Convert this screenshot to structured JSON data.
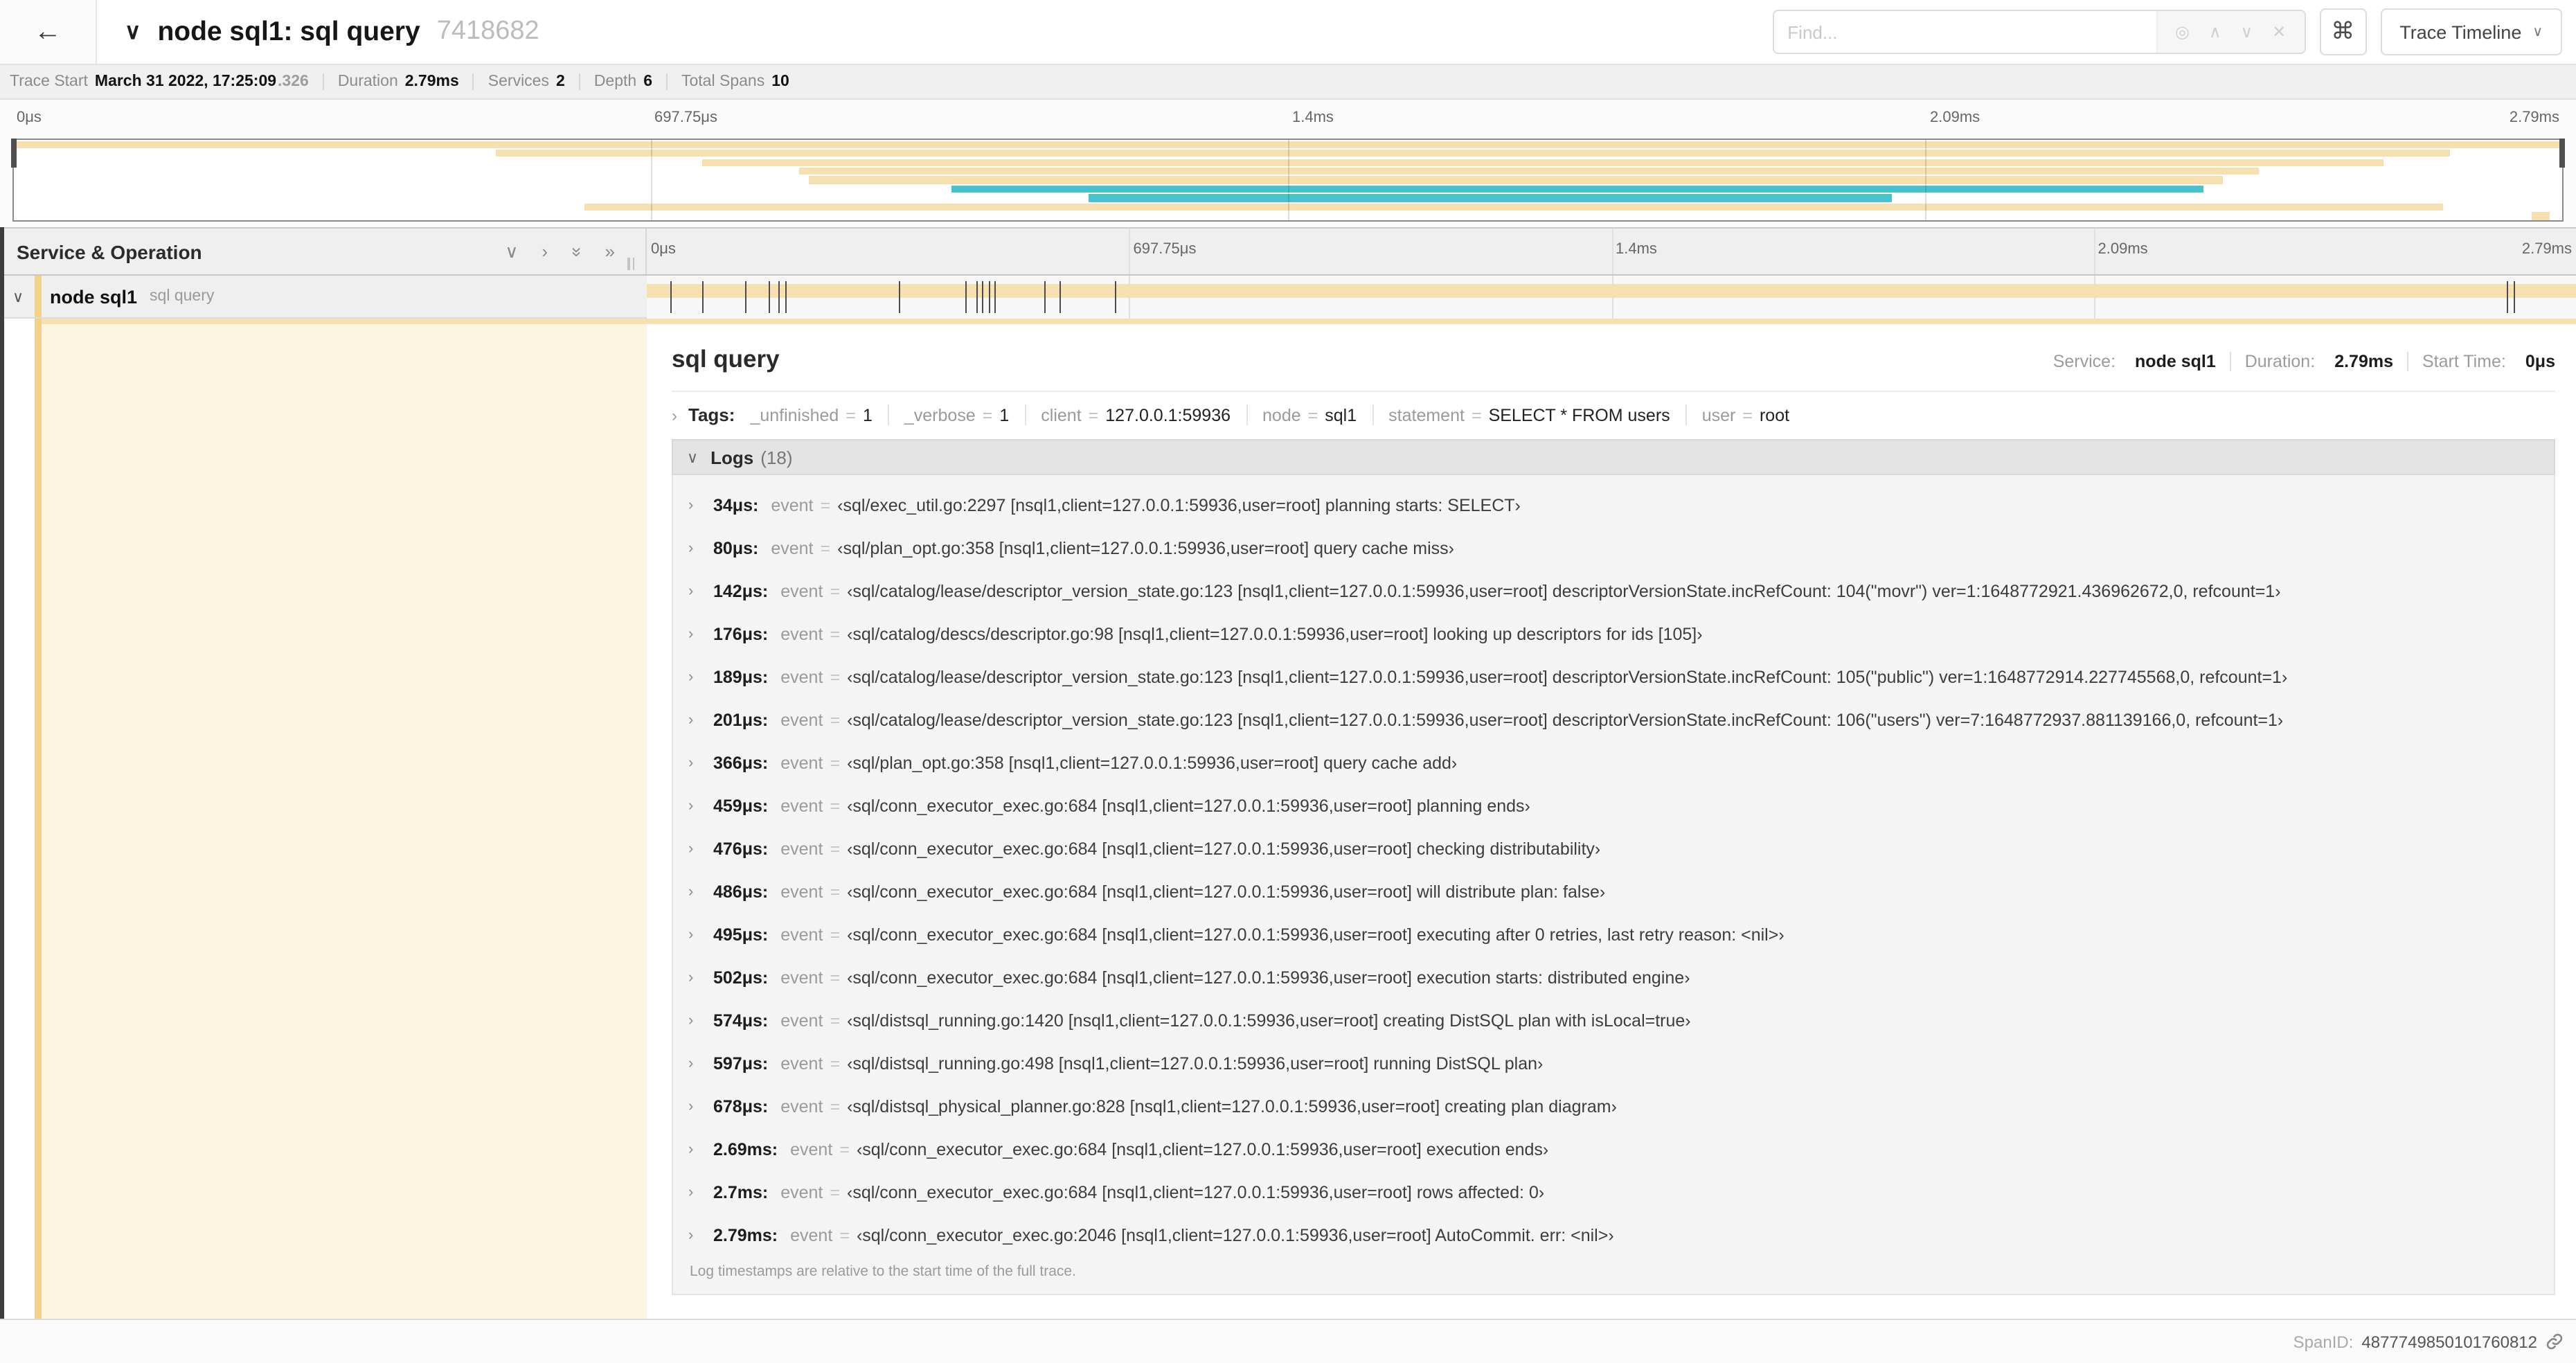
{
  "icons": {
    "back": "←",
    "collapse": "∨",
    "chevron_down": "∨",
    "chevron_right": "›",
    "double_chevron": "»",
    "locate": "◎",
    "prev": "∧",
    "next": "∨",
    "clear": "✕",
    "command": "⌘",
    "caret": "∨"
  },
  "header": {
    "title": "node sql1: sql query",
    "trace_id": "7418682",
    "find_placeholder": "Find...",
    "view_button": "Trace Timeline"
  },
  "trace_info": {
    "items": [
      {
        "label": "Trace Start",
        "value": "March 31 2022, 17:25:09",
        "suffix": ".326"
      },
      {
        "label": "Duration",
        "value": "2.79ms"
      },
      {
        "label": "Services",
        "value": "2"
      },
      {
        "label": "Depth",
        "value": "6"
      },
      {
        "label": "Total Spans",
        "value": "10"
      }
    ]
  },
  "timeline": {
    "tick_labels": [
      "0μs",
      "697.75μs",
      "1.4ms",
      "2.09ms",
      "2.79ms"
    ],
    "colors": {
      "tan": "#F7E0B0",
      "teal": "#46C3CB",
      "detail_bg": "#FDF4E1",
      "stripe": "#F2D28B"
    },
    "minimap_spans": [
      {
        "row": 0,
        "start": 0,
        "end": 100,
        "color": "tan"
      },
      {
        "row": 1,
        "start": 18.9,
        "end": 95.6,
        "color": "tan"
      },
      {
        "row": 2,
        "start": 27.0,
        "end": 93.0,
        "color": "tan"
      },
      {
        "row": 3,
        "start": 30.8,
        "end": 88.1,
        "color": "tan"
      },
      {
        "row": 4,
        "start": 31.2,
        "end": 86.7,
        "color": "tan"
      },
      {
        "row": 5,
        "start": 36.8,
        "end": 85.9,
        "color": "teal"
      },
      {
        "row": 6,
        "start": 42.2,
        "end": 73.7,
        "color": "teal"
      },
      {
        "row": 7,
        "start": 22.4,
        "end": 95.3,
        "color": "tan"
      },
      {
        "row": 8,
        "start": 98.8,
        "end": 99.5,
        "color": "tan"
      }
    ]
  },
  "left_head": {
    "label": "Service & Operation"
  },
  "span_row": {
    "service": "node sql1",
    "operation": "sql query",
    "tick_pcts": [
      1.2,
      2.9,
      5.1,
      6.3,
      6.8,
      7.2,
      13.1,
      16.5,
      17.1,
      17.4,
      17.7,
      18.0,
      20.6,
      21.4,
      24.3,
      96.4,
      96.8
    ]
  },
  "detail": {
    "title": "sql query",
    "summary": [
      {
        "label": "Service:",
        "value": "node sql1"
      },
      {
        "label": "Duration:",
        "value": "2.79ms"
      },
      {
        "label": "Start Time:",
        "value": "0μs"
      }
    ],
    "tags": {
      "label": "Tags:",
      "eq": "=",
      "items": [
        {
          "key": "_unfinished",
          "value": "1"
        },
        {
          "key": "_verbose",
          "value": "1"
        },
        {
          "key": "client",
          "value": "127.0.0.1:59936"
        },
        {
          "key": "node",
          "value": "sql1"
        },
        {
          "key": "statement",
          "value": "SELECT * FROM users"
        },
        {
          "key": "user",
          "value": "root"
        }
      ]
    },
    "logs": {
      "label": "Logs",
      "count": "(18)",
      "field": "event",
      "eq": "=",
      "entries": [
        {
          "time": "34μs:",
          "value": "‹sql/exec_util.go:2297 [nsql1,client=127.0.0.1:59936,user=root] planning starts: SELECT›"
        },
        {
          "time": "80μs:",
          "value": "‹sql/plan_opt.go:358 [nsql1,client=127.0.0.1:59936,user=root] query cache miss›"
        },
        {
          "time": "142μs:",
          "value": "‹sql/catalog/lease/descriptor_version_state.go:123 [nsql1,client=127.0.0.1:59936,user=root] descriptorVersionState.incRefCount: 104(\"movr\") ver=1:1648772921.436962672,0, refcount=1›"
        },
        {
          "time": "176μs:",
          "value": "‹sql/catalog/descs/descriptor.go:98 [nsql1,client=127.0.0.1:59936,user=root] looking up descriptors for ids [105]›"
        },
        {
          "time": "189μs:",
          "value": "‹sql/catalog/lease/descriptor_version_state.go:123 [nsql1,client=127.0.0.1:59936,user=root] descriptorVersionState.incRefCount: 105(\"public\") ver=1:1648772914.227745568,0, refcount=1›"
        },
        {
          "time": "201μs:",
          "value": "‹sql/catalog/lease/descriptor_version_state.go:123 [nsql1,client=127.0.0.1:59936,user=root] descriptorVersionState.incRefCount: 106(\"users\") ver=7:1648772937.881139166,0, refcount=1›"
        },
        {
          "time": "366μs:",
          "value": "‹sql/plan_opt.go:358 [nsql1,client=127.0.0.1:59936,user=root] query cache add›"
        },
        {
          "time": "459μs:",
          "value": "‹sql/conn_executor_exec.go:684 [nsql1,client=127.0.0.1:59936,user=root] planning ends›"
        },
        {
          "time": "476μs:",
          "value": "‹sql/conn_executor_exec.go:684 [nsql1,client=127.0.0.1:59936,user=root] checking distributability›"
        },
        {
          "time": "486μs:",
          "value": "‹sql/conn_executor_exec.go:684 [nsql1,client=127.0.0.1:59936,user=root] will distribute plan: false›"
        },
        {
          "time": "495μs:",
          "value": "‹sql/conn_executor_exec.go:684 [nsql1,client=127.0.0.1:59936,user=root] executing after 0 retries, last retry reason: <nil>›"
        },
        {
          "time": "502μs:",
          "value": "‹sql/conn_executor_exec.go:684 [nsql1,client=127.0.0.1:59936,user=root] execution starts: distributed engine›"
        },
        {
          "time": "574μs:",
          "value": "‹sql/distsql_running.go:1420 [nsql1,client=127.0.0.1:59936,user=root] creating DistSQL plan with isLocal=true›"
        },
        {
          "time": "597μs:",
          "value": "‹sql/distsql_running.go:498 [nsql1,client=127.0.0.1:59936,user=root] running DistSQL plan›"
        },
        {
          "time": "678μs:",
          "value": "‹sql/distsql_physical_planner.go:828 [nsql1,client=127.0.0.1:59936,user=root] creating plan diagram›"
        },
        {
          "time": "2.69ms:",
          "value": "‹sql/conn_executor_exec.go:684 [nsql1,client=127.0.0.1:59936,user=root] execution ends›"
        },
        {
          "time": "2.7ms:",
          "value": "‹sql/conn_executor_exec.go:684 [nsql1,client=127.0.0.1:59936,user=root] rows affected: 0›"
        },
        {
          "time": "2.79ms:",
          "value": "‹sql/conn_executor_exec.go:2046 [nsql1,client=127.0.0.1:59936,user=root] AutoCommit. err: <nil>›"
        }
      ],
      "footnote": "Log timestamps are relative to the start time of the full trace."
    }
  },
  "footer": {
    "label": "SpanID:",
    "value": "4877749850101760812"
  }
}
